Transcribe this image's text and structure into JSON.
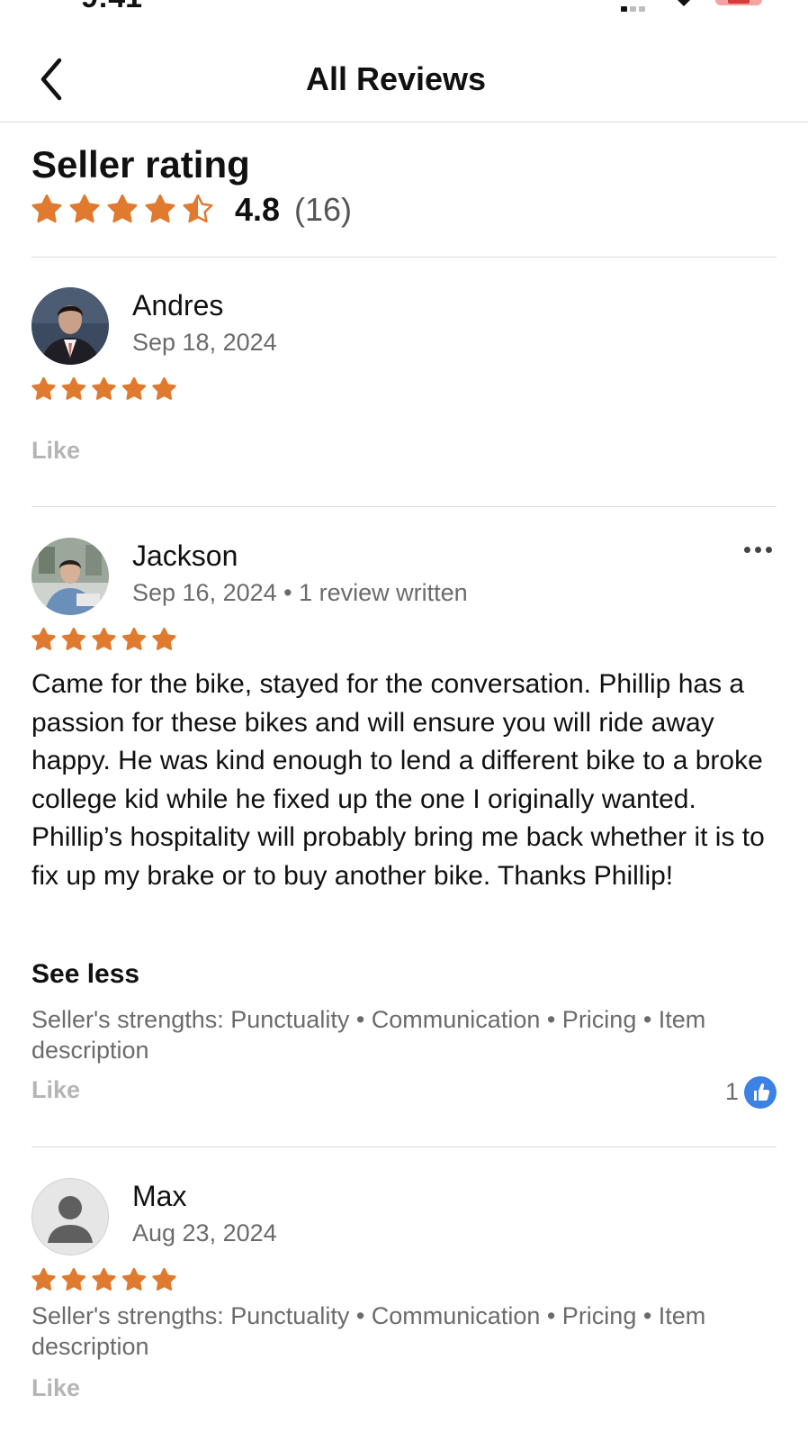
{
  "status_bar": {
    "time": "9:41"
  },
  "header": {
    "back_icon": "chevron-left-icon",
    "title": "All Reviews"
  },
  "summary": {
    "title": "Seller rating",
    "rating": "4.8",
    "count": "(16)",
    "stars_value": 4.5,
    "star_color": "#E07A2F"
  },
  "reviews": [
    {
      "name": "Andres",
      "date": "Sep 18, 2024",
      "stars": 5,
      "like_label": "Like"
    },
    {
      "name": "Jackson",
      "date": "Sep 16, 2024 • 1 review written",
      "stars": 5,
      "more_icon": "ellipsis-icon",
      "text": "Came for the bike, stayed for the conversation. Phillip has a passion for these bikes and will ensure you will ride away happy. He was kind enough to lend a different bike to a broke college kid while he fixed up the one I originally wanted. Phillip’s hospitality will probably bring me back whether it is to fix up my brake or to buy another bike. Thanks Phillip!",
      "see_less": "See less",
      "strengths": "Seller's strengths: Punctuality • Communication • Pricing • Item description",
      "like_label": "Like",
      "like_count": "1",
      "like_icon": "thumbs-up-icon",
      "like_badge_color": "#3B82E4"
    },
    {
      "name": "Max",
      "date": "Aug 23, 2024",
      "stars": 5,
      "strengths": "Seller's strengths: Punctuality • Communication • Pricing • Item description",
      "like_label": "Like"
    }
  ]
}
